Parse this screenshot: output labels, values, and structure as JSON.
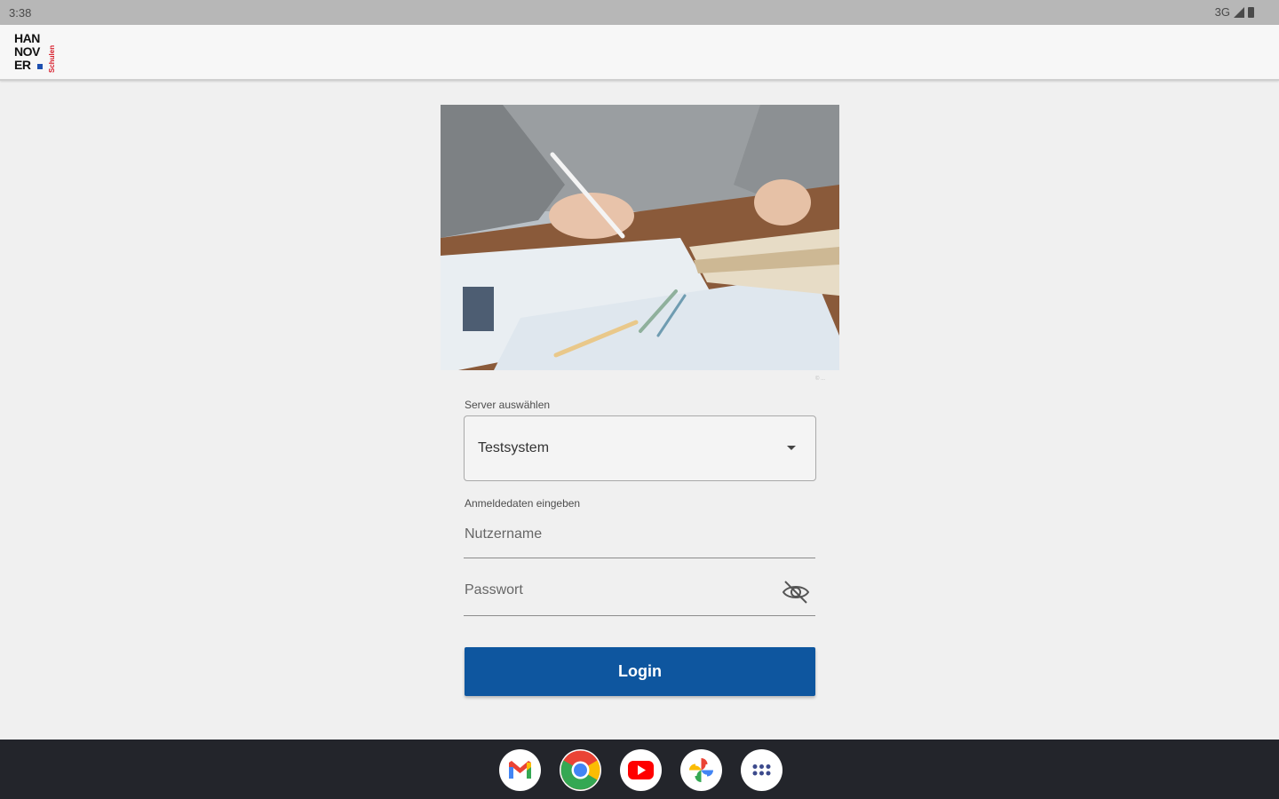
{
  "status_bar": {
    "time": "3:38",
    "network": "3G"
  },
  "app_bar": {
    "logo": {
      "line1": "HAN",
      "line2": "NOV",
      "line3": "ER",
      "side_text": "Schulen"
    }
  },
  "hero": {
    "image_credit": "© ..."
  },
  "form": {
    "server_label": "Server auswählen",
    "server_value": "Testsystem",
    "credentials_label": "Anmeldedaten eingeben",
    "username_placeholder": "Nutzername",
    "password_placeholder": "Passwort",
    "login_label": "Login"
  },
  "taskbar": {
    "apps": [
      "gmail-icon",
      "chrome-icon",
      "youtube-icon",
      "photos-icon",
      "app-launcher-icon"
    ]
  },
  "colors": {
    "primary": "#0e569f",
    "background": "#f0f0f0",
    "taskbar": "#23252b",
    "logo_accent": "#d8202e"
  }
}
